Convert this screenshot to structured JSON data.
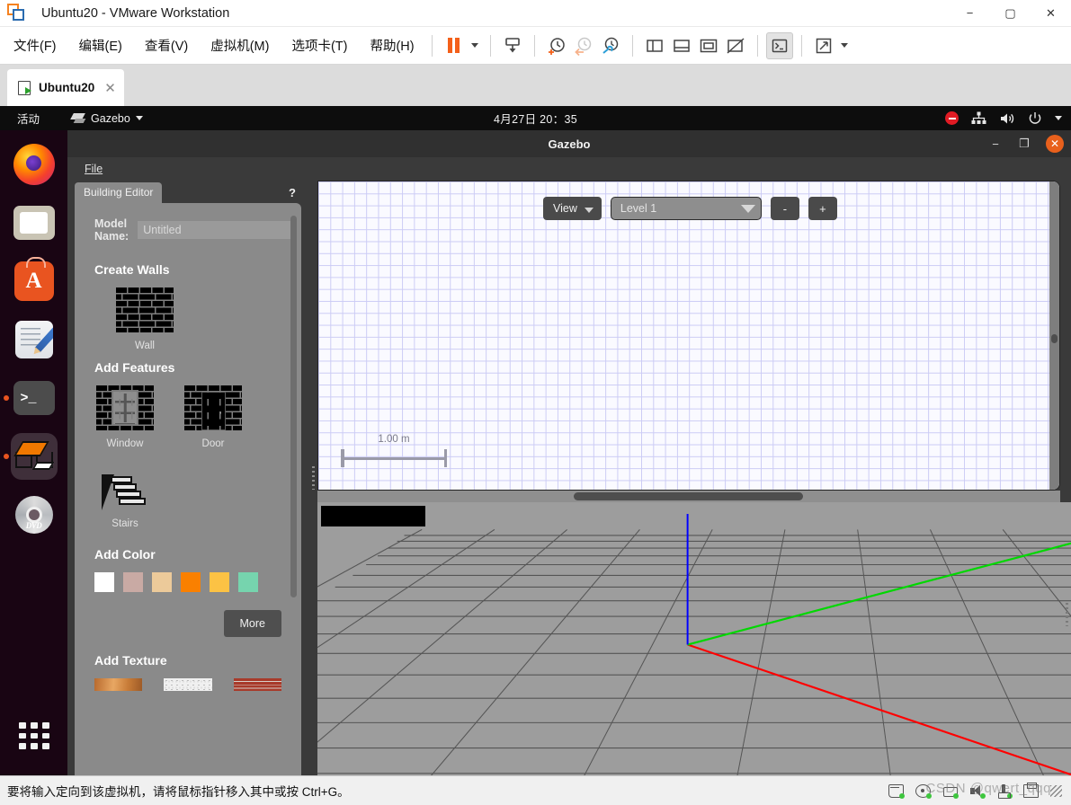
{
  "vmware": {
    "window_title": "Ubuntu20 - VMware Workstation",
    "logo_icon": "vmware-logo-icon",
    "menus": [
      {
        "label": "文件(F)",
        "accel": "F"
      },
      {
        "label": "编辑(E)",
        "accel": "E"
      },
      {
        "label": "查看(V)",
        "accel": "V"
      },
      {
        "label": "虚拟机(M)",
        "accel": "M"
      },
      {
        "label": "选项卡(T)",
        "accel": "T"
      },
      {
        "label": "帮助(H)",
        "accel": "H"
      }
    ],
    "toolbar": [
      {
        "name": "pause-vm-button",
        "icon": "pause-icon"
      },
      {
        "name": "pause-dropdown",
        "icon": "chevron-down-icon"
      },
      {
        "name": "send-ctrl-alt-del-button",
        "icon": "keyboard-send-icon"
      },
      {
        "name": "take-snapshot-button",
        "icon": "snapshot-add-icon"
      },
      {
        "name": "revert-snapshot-button",
        "icon": "snapshot-revert-icon"
      },
      {
        "name": "snapshot-manager-button",
        "icon": "snapshot-manage-icon"
      },
      {
        "name": "show-left-pane-button",
        "icon": "panel-left-icon"
      },
      {
        "name": "show-bottom-pane-button",
        "icon": "panel-bottom-icon"
      },
      {
        "name": "show-thumbnail-bar-button",
        "icon": "thumbnail-bar-icon"
      },
      {
        "name": "hide-thumbnail-bar-button",
        "icon": "thumbnail-off-icon"
      },
      {
        "name": "console-view-button",
        "icon": "console-icon"
      },
      {
        "name": "fullscreen-button",
        "icon": "expand-icon"
      },
      {
        "name": "fullscreen-dropdown",
        "icon": "chevron-down-icon"
      }
    ],
    "window_buttons": {
      "minimize": "−",
      "maximize": "▢",
      "close": "✕"
    },
    "tab": {
      "label": "Ubuntu20",
      "close": "✕",
      "icon": "vm-running-icon"
    },
    "status": {
      "message": "要将输入定向到该虚拟机，请将鼠标指针移入其中或按 Ctrl+G。",
      "devices": [
        {
          "name": "status-device-harddisk",
          "icon": "harddisk-icon"
        },
        {
          "name": "status-device-cdrom",
          "icon": "cd-icon"
        },
        {
          "name": "status-device-network",
          "icon": "network-icon"
        },
        {
          "name": "status-device-sound",
          "icon": "sound-icon"
        },
        {
          "name": "status-device-usb",
          "icon": "usb-icon"
        },
        {
          "name": "status-device-printer",
          "icon": "printer-icon"
        }
      ]
    },
    "watermark": "CSDN @qwert_qqq"
  },
  "ubuntu": {
    "topbar": {
      "activities": "活动",
      "app_menu": "Gazebo",
      "app_menu_icon": "gazebo-icon",
      "clock": "4月27日 20：35",
      "tray": [
        {
          "name": "do-not-disturb-icon",
          "color": "#e01b24"
        },
        {
          "name": "network-icon"
        },
        {
          "name": "volume-icon"
        },
        {
          "name": "power-icon"
        },
        {
          "name": "chevron-down-icon"
        }
      ]
    },
    "dock": [
      {
        "name": "dock-item-firefox",
        "icon": "firefox-icon",
        "running": false
      },
      {
        "name": "dock-item-files",
        "icon": "files-icon",
        "running": false
      },
      {
        "name": "dock-item-software",
        "icon": "ubuntu-software-icon",
        "running": false
      },
      {
        "name": "dock-item-text-editor",
        "icon": "text-editor-icon",
        "running": false
      },
      {
        "name": "dock-item-terminal",
        "icon": "terminal-icon",
        "running": true
      },
      {
        "name": "dock-item-gazebo",
        "icon": "gazebo-icon",
        "running": true,
        "active": true
      },
      {
        "name": "dock-item-dvd",
        "icon": "dvd-icon",
        "running": false,
        "label": "DVD"
      },
      {
        "name": "dock-item-show-apps",
        "icon": "app-grid-icon",
        "running": false
      }
    ]
  },
  "gazebo": {
    "window_title": "Gazebo",
    "window_buttons": {
      "minimize": "−",
      "maximize": "❐",
      "close": "✕"
    },
    "menus": [
      {
        "label": "File",
        "accel": "F"
      }
    ],
    "panel": {
      "tab_label": "Building Editor",
      "help_label": "?",
      "model_name_label": "Model Name:",
      "model_name_value": "Untitled",
      "sections": [
        {
          "title": "Create Walls",
          "items": [
            {
              "label": "Wall",
              "icon": "wall-brick-icon"
            }
          ]
        },
        {
          "title": "Add Features",
          "items": [
            {
              "label": "Window",
              "icon": "window-icon"
            },
            {
              "label": "Door",
              "icon": "door-icon"
            },
            {
              "label": "Stairs",
              "icon": "stairs-icon"
            }
          ]
        },
        {
          "title": "Add Color",
          "swatches": [
            "#ffffff",
            "#c9aaa4",
            "#ecca9a",
            "#fa8000",
            "#fcc244",
            "#76d4ae"
          ],
          "more_button": "More"
        },
        {
          "title": "Add Texture",
          "textures": [
            {
              "name": "texture-wood",
              "label": "Wood"
            },
            {
              "name": "texture-granite",
              "label": "Granite"
            },
            {
              "name": "texture-brick",
              "label": "Brick"
            }
          ]
        }
      ]
    },
    "editor2d": {
      "view_button": "View",
      "level_select": "Level 1",
      "zoom_out": "-",
      "zoom_in": "+",
      "scale_label": "1.00 m",
      "grid_color": "#ccccf5",
      "background": "#fafaff"
    },
    "view3d": {
      "axes": [
        {
          "name": "x-axis",
          "color": "#ff0000"
        },
        {
          "name": "y-axis",
          "color": "#00d800"
        },
        {
          "name": "z-axis",
          "color": "#0000ff"
        }
      ],
      "ground_color": "#9d9d9d",
      "grid_line_color": "#555555"
    }
  }
}
